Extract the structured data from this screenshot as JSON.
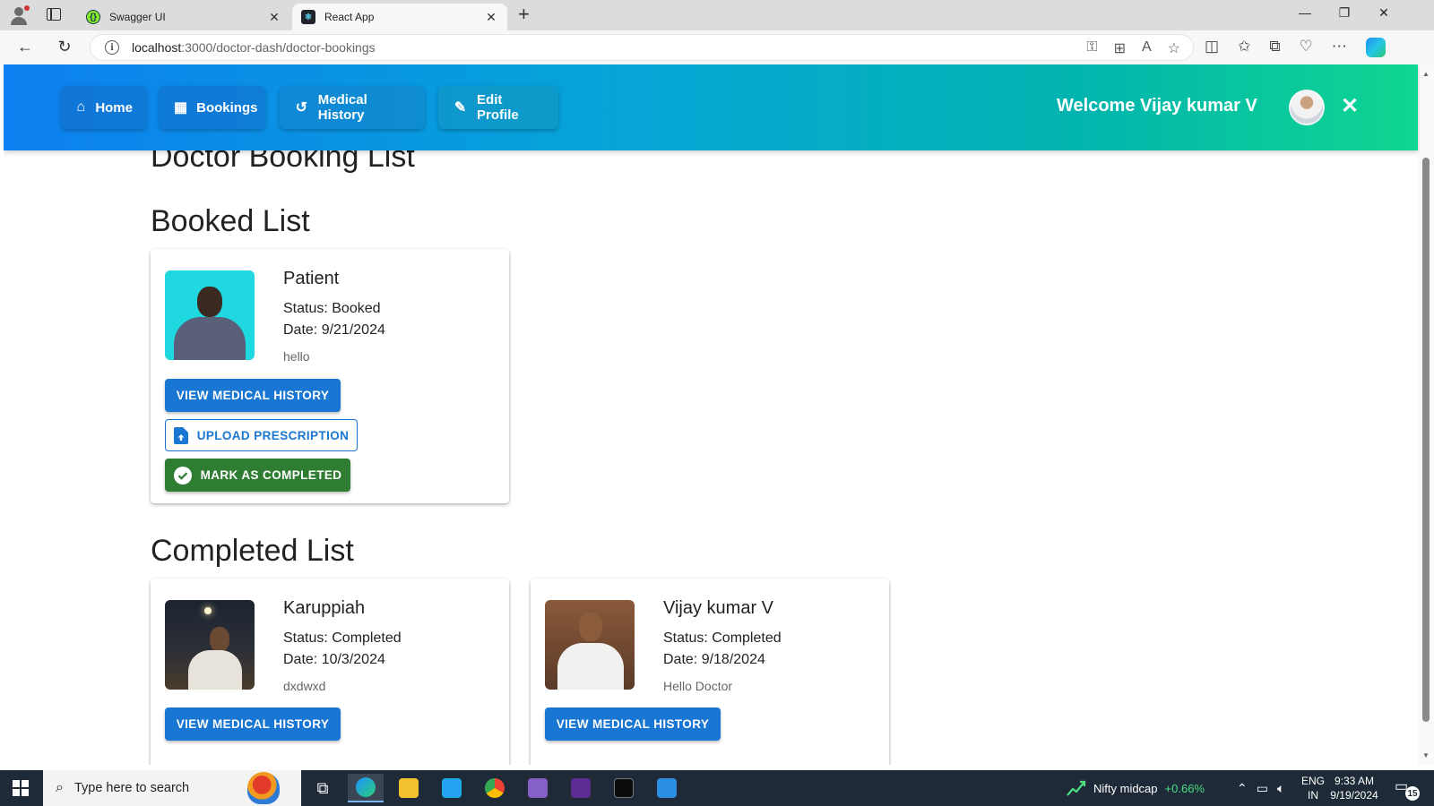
{
  "browser": {
    "tabs": [
      {
        "title": "Swagger UI",
        "favicon": "swagger-icon",
        "active": false
      },
      {
        "title": "React App",
        "favicon": "react-icon",
        "active": true
      }
    ],
    "url_host": "localhost",
    "url_path": ":3000/doctor-dash/doctor-bookings"
  },
  "navbar": {
    "items": [
      {
        "label": "Home",
        "icon": "home-icon"
      },
      {
        "label": "Bookings",
        "icon": "calendar-icon"
      },
      {
        "label": "Medical History",
        "icon": "history-icon"
      },
      {
        "label": "Edit Profile",
        "icon": "pencil-icon"
      }
    ],
    "welcome": "Welcome Vijay kumar V",
    "gradient_colors": [
      "#0d7ff0",
      "#0fd690"
    ]
  },
  "page": {
    "title": "Doctor Booking List",
    "booked_heading": "Booked List",
    "completed_heading": "Completed List"
  },
  "booked": [
    {
      "name": "Patient",
      "status": "Status: Booked",
      "date": "Date: 9/21/2024",
      "note": "hello",
      "buttons": {
        "view": "VIEW MEDICAL HISTORY",
        "upload": "UPLOAD PRESCRIPTION",
        "complete": "MARK AS COMPLETED"
      }
    }
  ],
  "completed": [
    {
      "name": "Karuppiah",
      "status": "Status: Completed",
      "date": "Date: 10/3/2024",
      "note": "dxdwxd",
      "button": "VIEW MEDICAL HISTORY"
    },
    {
      "name": "Vijay kumar V",
      "status": "Status: Completed",
      "date": "Date: 9/18/2024",
      "note": "Hello Doctor",
      "button": "VIEW MEDICAL HISTORY"
    }
  ],
  "colors": {
    "primary": "#1976d2",
    "success": "#2e7d32"
  },
  "taskbar": {
    "search_placeholder": "Type here to search",
    "ticker_name": "Nifty midcap",
    "ticker_change": "+0.66%",
    "lang_line1": "ENG",
    "lang_line2": "IN",
    "time": "9:33 AM",
    "date": "9/19/2024",
    "notification_count": "15"
  }
}
